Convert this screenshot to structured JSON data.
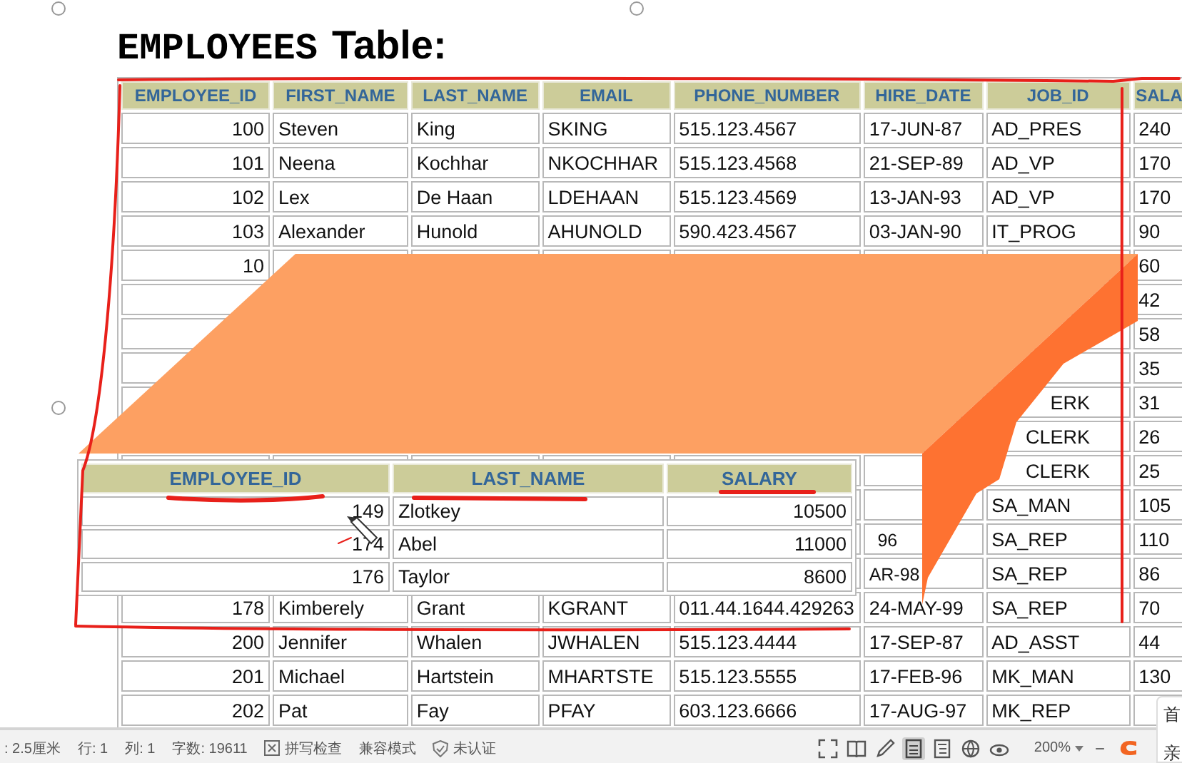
{
  "title": {
    "code": "EMPLOYEES",
    "text": "Table:"
  },
  "employees_table": {
    "columns": [
      "EMPLOYEE_ID",
      "FIRST_NAME",
      "LAST_NAME",
      "EMAIL",
      "PHONE_NUMBER",
      "HIRE_DATE",
      "JOB_ID",
      "SALA"
    ],
    "rows": [
      [
        "100",
        "Steven",
        "King",
        "SKING",
        "515.123.4567",
        "17-JUN-87",
        "AD_PRES",
        "240"
      ],
      [
        "101",
        "Neena",
        "Kochhar",
        "NKOCHHAR",
        "515.123.4568",
        "21-SEP-89",
        "AD_VP",
        "170"
      ],
      [
        "102",
        "Lex",
        "De Haan",
        "LDEHAAN",
        "515.123.4569",
        "13-JAN-93",
        "AD_VP",
        "170"
      ],
      [
        "103",
        "Alexander",
        "Hunold",
        "AHUNOLD",
        "590.423.4567",
        "03-JAN-90",
        "IT_PROG",
        "90"
      ],
      [
        "10",
        null,
        null,
        null,
        null,
        null,
        null,
        "60"
      ],
      [
        null,
        null,
        null,
        null,
        null,
        null,
        null,
        "42"
      ],
      [
        null,
        null,
        null,
        null,
        null,
        null,
        null,
        "58"
      ],
      [
        null,
        null,
        null,
        null,
        null,
        null,
        null,
        "35"
      ],
      [
        null,
        null,
        null,
        null,
        null,
        null,
        {
          "text": "ERK",
          "kind": "tail"
        },
        "31"
      ],
      [
        null,
        null,
        null,
        null,
        null,
        null,
        {
          "text": "CLERK",
          "kind": "tail"
        },
        "26"
      ],
      [
        null,
        null,
        null,
        null,
        null,
        null,
        {
          "text": "CLERK",
          "kind": "tail"
        },
        "25"
      ],
      [
        null,
        null,
        null,
        null,
        null,
        null,
        "SA_MAN",
        "105"
      ],
      [
        null,
        null,
        null,
        null,
        null,
        {
          "text": "96",
          "kind": "tail"
        },
        "SA_REP",
        "110"
      ],
      [
        null,
        null,
        null,
        null,
        null,
        {
          "text": "AR-98",
          "kind": "tail"
        },
        "SA_REP",
        "86"
      ],
      [
        "178",
        "Kimberely",
        "Grant",
        "KGRANT",
        "011.44.1644.429263",
        "24-MAY-99",
        "SA_REP",
        "70"
      ],
      [
        "200",
        "Jennifer",
        "Whalen",
        "JWHALEN",
        "515.123.4444",
        "17-SEP-87",
        "AD_ASST",
        "44"
      ],
      [
        "201",
        "Michael",
        "Hartstein",
        "MHARTSTE",
        "515.123.5555",
        "17-FEB-96",
        "MK_MAN",
        "130"
      ],
      [
        "202",
        "Pat",
        "Fay",
        "PFAY",
        "603.123.6666",
        "17-AUG-97",
        "MK_REP",
        null
      ]
    ]
  },
  "highlight_table": {
    "columns": [
      "EMPLOYEE_ID",
      "LAST_NAME",
      "SALARY"
    ],
    "rows": [
      [
        "149",
        "Zlotkey",
        "10500"
      ],
      [
        "174",
        "Abel",
        "11000"
      ],
      [
        "176",
        "Taylor",
        "8600"
      ]
    ]
  },
  "status_bar": {
    "items": [
      {
        "kind": "text",
        "text": ": 2.5厘米"
      },
      {
        "kind": "text",
        "text": "行: 1"
      },
      {
        "kind": "text",
        "text": "列: 1"
      },
      {
        "kind": "text",
        "text": "字数: 19611"
      },
      {
        "kind": "checkbox",
        "text": "拼写检查"
      },
      {
        "kind": "text",
        "text": "兼容模式"
      },
      {
        "kind": "shield",
        "text": "未认证"
      }
    ],
    "views": [
      {
        "kind": "fullscreen",
        "selected": false
      },
      {
        "kind": "book",
        "selected": false
      },
      {
        "kind": "pen",
        "selected": false
      },
      {
        "kind": "page",
        "selected": true
      },
      {
        "kind": "outline",
        "selected": false
      },
      {
        "kind": "globe",
        "selected": false
      },
      {
        "kind": "eye",
        "selected": false
      }
    ],
    "zoom": "200%",
    "zoom_out": "−"
  },
  "side_panel": {
    "chars": [
      "首",
      "亲"
    ]
  }
}
